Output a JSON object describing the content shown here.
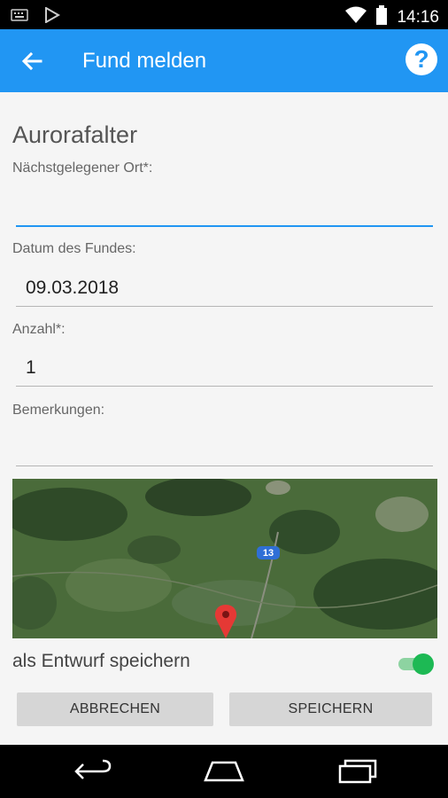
{
  "status_bar": {
    "time": "14:16",
    "icons": [
      "keyboard-icon",
      "play-store-icon",
      "wifi-icon",
      "battery-icon"
    ]
  },
  "app_bar": {
    "title": "Fund melden",
    "back_icon": "arrow-back-icon",
    "help_icon": "help-icon",
    "help_symbol": "?",
    "color": "#2196f3"
  },
  "form": {
    "species": "Aurorafalter",
    "location": {
      "label": "Nächstgelegener Ort*:",
      "value": ""
    },
    "date": {
      "label": "Datum des Fundes:",
      "value": "09.03.2018"
    },
    "count": {
      "label": "Anzahl*:",
      "value": "1"
    },
    "remarks": {
      "label": "Bemerkungen:",
      "value": ""
    }
  },
  "map": {
    "route_label": "13",
    "marker_icon": "map-pin-icon"
  },
  "draft": {
    "label": "als Entwurf speichern",
    "enabled": true,
    "toggle_color": "#1db954"
  },
  "buttons": {
    "cancel": "ABBRECHEN",
    "save": "SPEICHERN"
  },
  "nav_bar": {
    "icons": [
      "back-nav-icon",
      "home-nav-icon",
      "recents-nav-icon"
    ]
  }
}
